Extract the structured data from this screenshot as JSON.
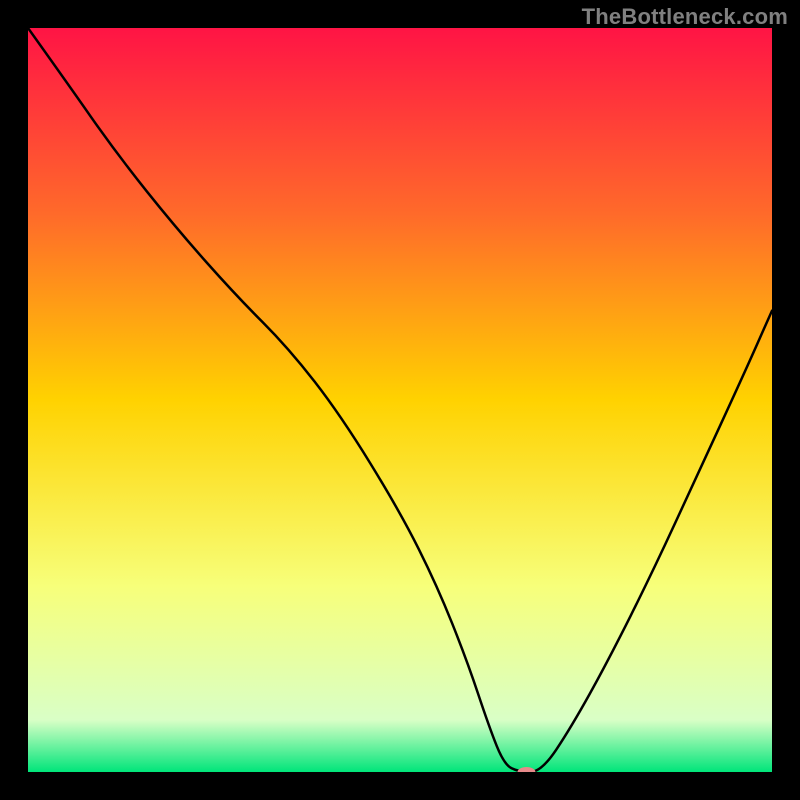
{
  "watermark": "TheBottleneck.com",
  "chart_data": {
    "type": "line",
    "title": "",
    "xlabel": "",
    "ylabel": "",
    "xlim": [
      0,
      100
    ],
    "ylim": [
      0,
      100
    ],
    "grid": false,
    "legend": false,
    "gradient_stops": [
      {
        "offset": 0,
        "color": "#ff1445"
      },
      {
        "offset": 25,
        "color": "#ff6a2a"
      },
      {
        "offset": 50,
        "color": "#ffd200"
      },
      {
        "offset": 75,
        "color": "#f7ff7a"
      },
      {
        "offset": 93,
        "color": "#d9ffc6"
      },
      {
        "offset": 100,
        "color": "#00e57a"
      }
    ],
    "series": [
      {
        "name": "bottleneck-curve",
        "color": "#000000",
        "x": [
          0,
          5,
          12,
          20,
          28,
          35,
          42,
          50,
          55,
          59,
          62,
          64,
          66,
          69,
          73,
          78,
          84,
          90,
          96,
          100
        ],
        "y": [
          100,
          93,
          83,
          73,
          64,
          57,
          48,
          35,
          25,
          15,
          6,
          1,
          0,
          0,
          6,
          15,
          27,
          40,
          53,
          62
        ]
      }
    ],
    "marker": {
      "x": 67,
      "y": 0,
      "color": "#e68a8a",
      "rx": 9,
      "ry": 5
    }
  }
}
